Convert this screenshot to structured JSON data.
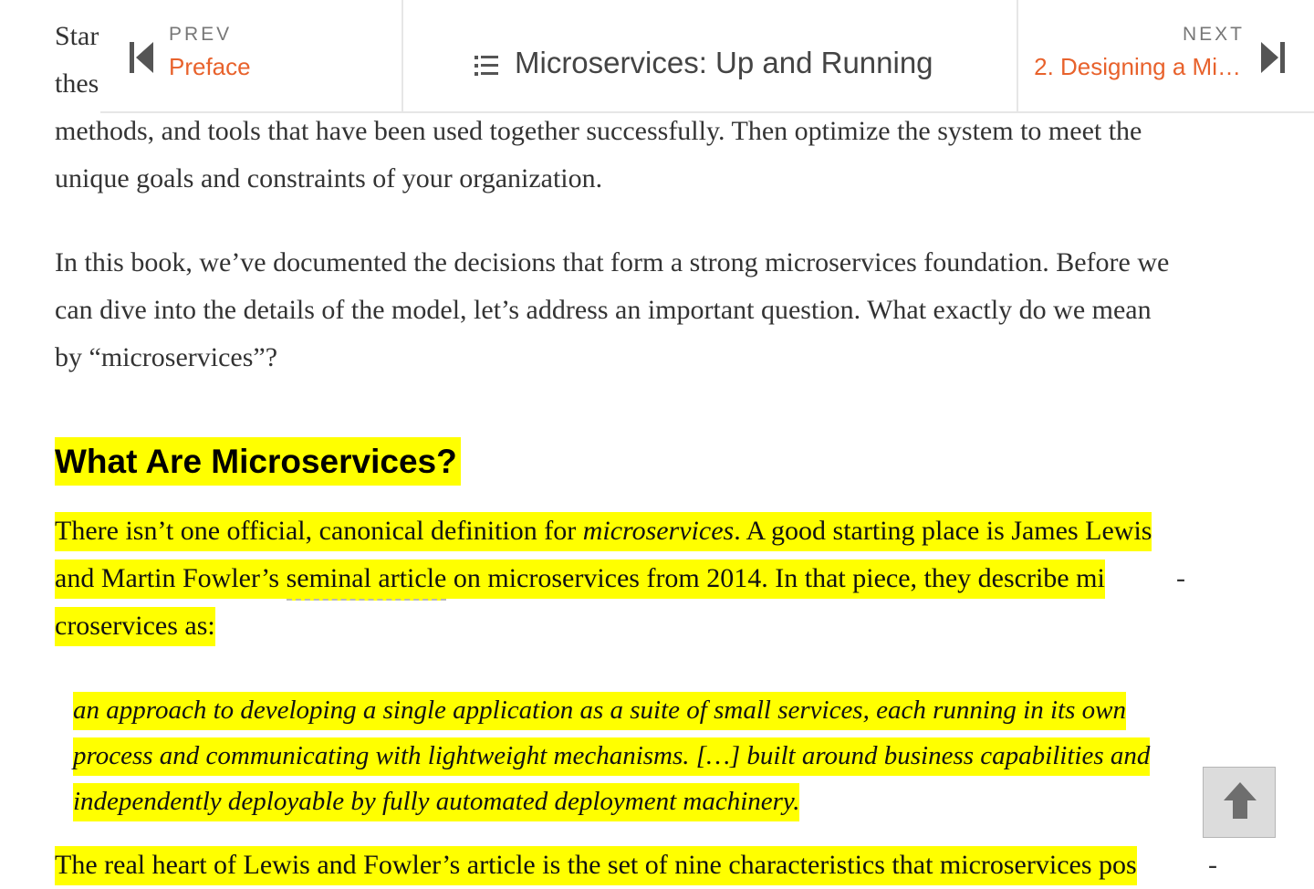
{
  "nav": {
    "prev_kicker": "PREV",
    "prev_title": "Preface",
    "book_title": "Microservices: Up and Running",
    "next_kicker": "NEXT",
    "next_title": "2. Designing a Mi…"
  },
  "content": {
    "partial_line_1": "Star",
    "partial_line_2": "thes",
    "para1_line3": "methods, and tools that have been used together successfully. Then optimize the system to meet the",
    "para1_line4": "unique goals and constraints of your organization.",
    "para2_line1": "In this book, we’ve documented the decisions that form a strong microservices foundation. Before we",
    "para2_line2": "can dive into the details of the model, let’s address an important question. What exactly do we mean",
    "para2_line3": "by “microservices”?",
    "heading": "What Are Microservices?",
    "def_l1_a": "There isn’t one official, canonical definition for ",
    "def_l1_em": "microservices",
    "def_l1_b": ". A good starting place is James Lewis",
    "def_l2_a": "and Martin Fowler’s ",
    "def_l2_link": "seminal article",
    "def_l2_b": " on microservices from 2014. In that piece, they describe mi",
    "def_l2_hyphen": "-",
    "def_l3": "croservices as:",
    "quote_l1": "an approach to developing a single application as a suite of small services, each running in its own",
    "quote_l2": "process and communicating with lightweight mechanisms. […] built around business capabilities and",
    "quote_l3": "independently deployable by fully automated deployment machinery.",
    "last_line_a": "The real heart of Lewis and Fowler’s article is the set of nine characteristics that microservices pos",
    "last_line_hyphen": "-"
  },
  "colors": {
    "highlight": "#ffff00",
    "accent": "#e8622c",
    "text": "#333333"
  },
  "icons": {
    "prev": "skip-previous-icon",
    "toc": "list-icon",
    "next": "skip-next-icon",
    "back_to_top": "arrow-up-icon"
  }
}
